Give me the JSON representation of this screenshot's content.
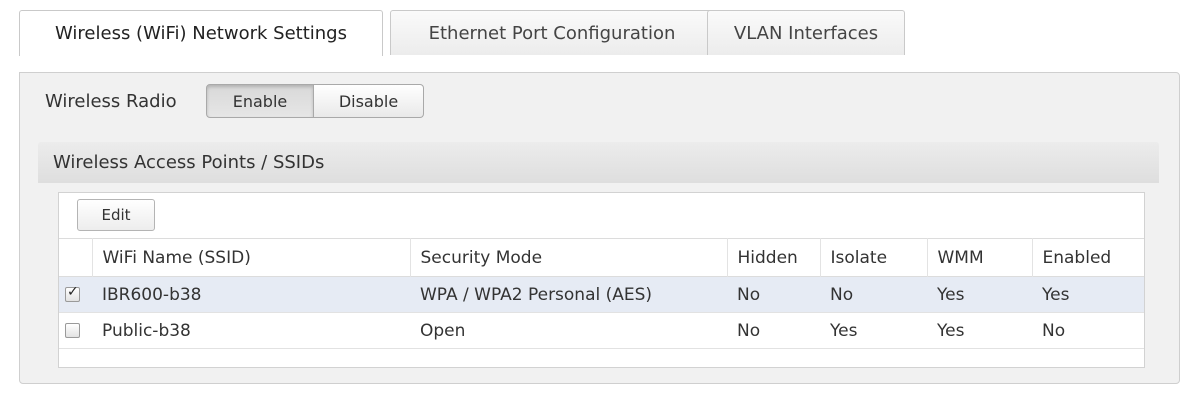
{
  "tabs": [
    {
      "label": "Wireless (WiFi) Network Settings",
      "active": true
    },
    {
      "label": "Ethernet Port Configuration",
      "active": false
    },
    {
      "label": "VLAN Interfaces",
      "active": false
    }
  ],
  "radio": {
    "label": "Wireless Radio",
    "enable_label": "Enable",
    "disable_label": "Disable",
    "selected": "Enable"
  },
  "section": {
    "title": "Wireless Access Points / SSIDs",
    "edit_label": "Edit"
  },
  "table": {
    "columns": [
      "WiFi Name (SSID)",
      "Security Mode",
      "Hidden",
      "Isolate",
      "WMM",
      "Enabled"
    ],
    "rows": [
      {
        "checked": true,
        "cells": [
          "IBR600-b38",
          "WPA / WPA2 Personal (AES)",
          "No",
          "No",
          "Yes",
          "Yes"
        ]
      },
      {
        "checked": false,
        "cells": [
          "Public-b38",
          "Open",
          "No",
          "Yes",
          "Yes",
          "No"
        ]
      }
    ]
  }
}
